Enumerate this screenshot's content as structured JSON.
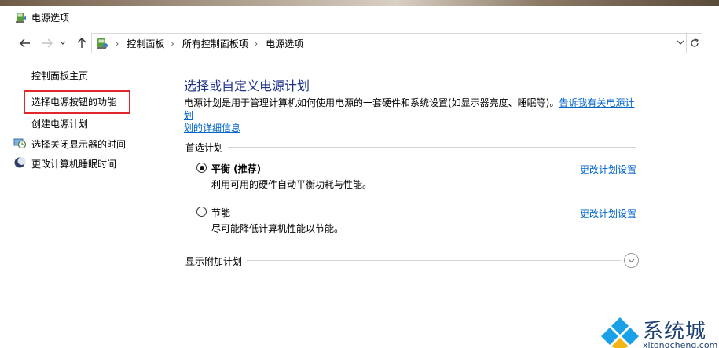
{
  "window": {
    "title": "电源选项",
    "icon": "power-options-icon"
  },
  "address": {
    "crumbs": [
      "控制面板",
      "所有控制面板项",
      "电源选项"
    ],
    "icon": "control-panel-icon"
  },
  "sidebar": {
    "home_link": "控制面板主页",
    "items": [
      {
        "label": "选择电源按钮的功能",
        "icon": null,
        "highlighted": true
      },
      {
        "label": "创建电源计划",
        "icon": null
      },
      {
        "label": "选择关闭显示器的时间",
        "icon": "monitor-clock-icon"
      },
      {
        "label": "更改计算机睡眠时间",
        "icon": "moon-icon"
      }
    ]
  },
  "main": {
    "heading": "选择或自定义电源计划",
    "description_prefix": "电源计划是用于管理计算机如何使用电源的一套硬件和系统设置(如显示器亮度、睡眠等)。",
    "description_link_line1": "告诉我有关电源计划",
    "description_link_line2": "划的详细信息",
    "preferred_label": "首选计划",
    "plans": [
      {
        "name": "平衡 (推荐)",
        "description": "利用可用的硬件自动平衡功耗与性能。",
        "selected": true,
        "link": "更改计划设置"
      },
      {
        "name": "节能",
        "description": "尽可能降低计算机性能以节能。",
        "selected": false,
        "link": "更改计划设置"
      }
    ],
    "show_more_label": "显示附加计划"
  },
  "watermark": {
    "text": "系统城",
    "url": "xitongcheng.com"
  },
  "colors": {
    "heading": "#1e3287",
    "link": "#0066cc",
    "highlight_border": "#e3262b"
  }
}
